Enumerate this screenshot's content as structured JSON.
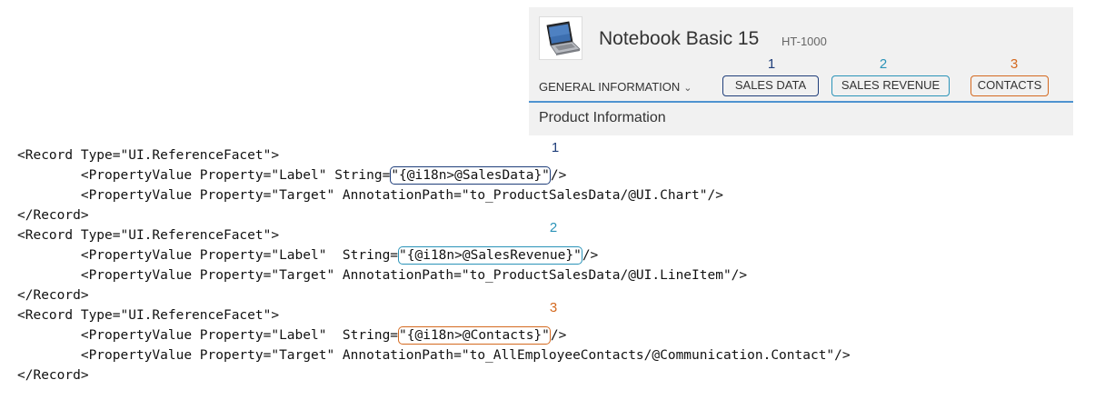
{
  "colors": {
    "one": "#1f3e7a",
    "two": "#2a93b8",
    "three": "#d4691f",
    "panel_bg": "#f1f1f1",
    "anchor_line": "#4e93d0"
  },
  "header": {
    "thumbnail_icon": "laptop-image",
    "title": "Notebook Basic 15",
    "id": "HT-1000"
  },
  "anchor_bar": {
    "general": "GENERAL INFORMATION",
    "general_icon": "chevron-down-icon",
    "sales_data": "SALES DATA",
    "sales_revenue": "SALES REVENUE",
    "contacts": "CONTACTS",
    "numbers": [
      "1",
      "2",
      "3"
    ]
  },
  "section": {
    "title": "Product Information"
  },
  "code": {
    "record1_open": "<Record Type=\"UI.ReferenceFacet\">",
    "record1_label_pre": "        <PropertyValue Property=\"Label\" String=",
    "record1_label_val": "\"{@i18n>@SalesData}\"",
    "record1_label_post": "/>",
    "record1_target": "        <PropertyValue Property=\"Target\" AnnotationPath=\"to_ProductSalesData/@UI.Chart\"/>",
    "record1_close": "</Record>",
    "record2_open": "<Record Type=\"UI.ReferenceFacet\">",
    "record2_label_pre": "        <PropertyValue Property=\"Label\"  String=",
    "record2_label_val": "\"{@i18n>@SalesRevenue}\"",
    "record2_label_post": "/>",
    "record2_target": "        <PropertyValue Property=\"Target\" AnnotationPath=\"to_ProductSalesData/@UI.LineItem\"/>",
    "record2_close": "</Record>",
    "record3_open": "<Record Type=\"UI.ReferenceFacet\">",
    "record3_label_pre": "        <PropertyValue Property=\"Label\"  String=",
    "record3_label_val": "\"{@i18n>@Contacts}\"",
    "record3_label_post": "/>",
    "record3_target": "        <PropertyValue Property=\"Target\" AnnotationPath=\"to_AllEmployeeContacts/@Communication.Contact\"/>",
    "record3_close": "</Record>",
    "numbers": [
      "1",
      "2",
      "3"
    ]
  }
}
